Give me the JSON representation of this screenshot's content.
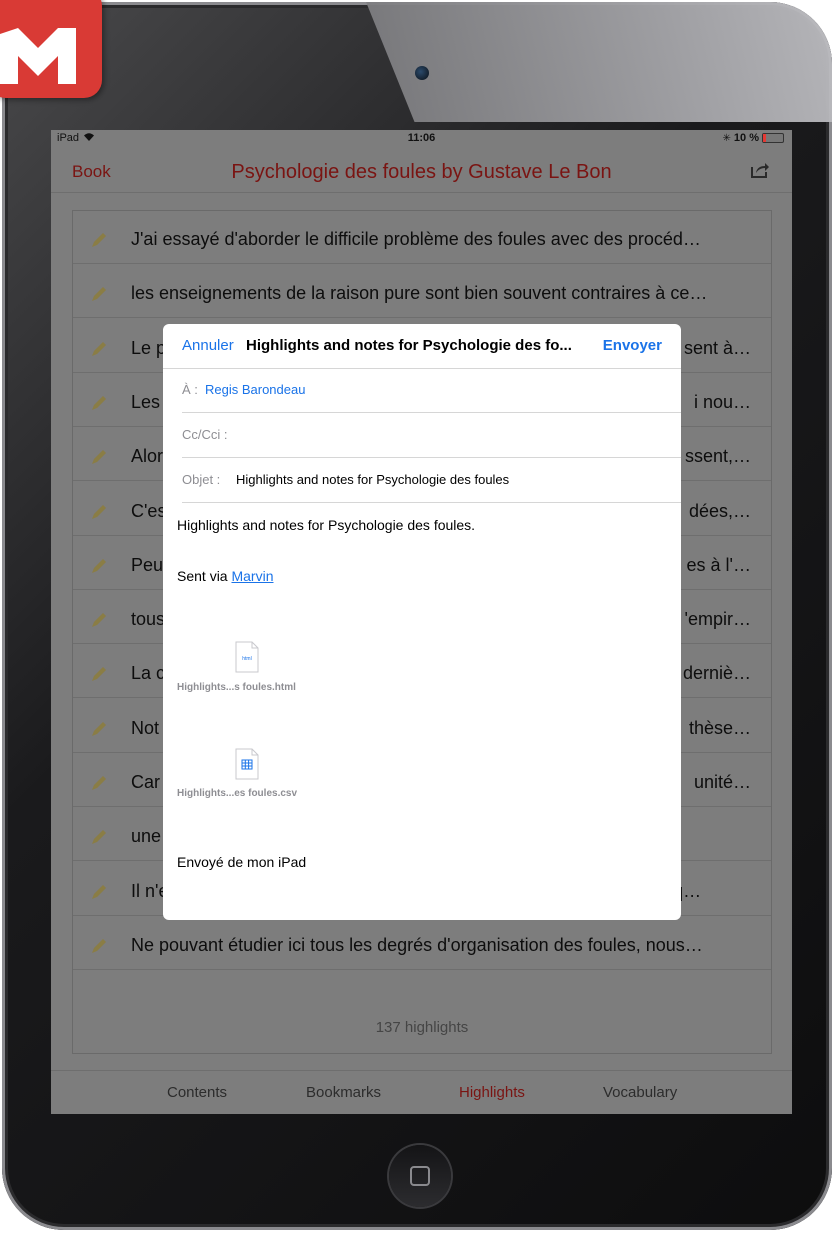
{
  "status": {
    "device": "iPad",
    "time": "11:06",
    "battery": "10 %"
  },
  "nav": {
    "back": "Book",
    "title": "Psychologie des foules by Gustave Le Bon",
    "share_icon": "share-icon"
  },
  "highlights": [
    "J'ai essayé d'aborder le difficile problème des foules avec des procéd…",
    "les enseignements de la raison  pure sont bien souvent contraires à ce…",
    "Le p",
    "Les",
    "Alor",
    "C'es",
    "Peu",
    "tous",
    "La c",
    "Not",
    "Car",
    "une",
    "Il n'est pas facile de décrire avec exactitude l'âme  des foules, parce q…",
    "Ne pouvant étudier ici tous les degrés d'organisation des foules, nous…"
  ],
  "highlights_right": [
    "",
    "",
    "sent à…",
    "i nou…",
    "ssent,…",
    "dées,…",
    "es à l'…",
    "'empir…",
    "derniè…",
    "thèse…",
    "unité…",
    "",
    "",
    ""
  ],
  "count": "137 highlights",
  "tabs": [
    "Contents",
    "Bookmarks",
    "Highlights",
    "Vocabulary"
  ],
  "compose": {
    "cancel": "Annuler",
    "title": "Highlights and notes for Psychologie des fo...",
    "send": "Envoyer",
    "to_label": "À :",
    "to_value": "Regis Barondeau",
    "cc_label": "Cc/Cci :",
    "subject_label": "Objet :",
    "subject_value": "Highlights and notes for Psychologie des foules",
    "body": "Highlights and notes for Psychologie des foules.",
    "sent_via": "Sent via",
    "sent_link": "Marvin",
    "attachments": [
      {
        "name": "Highlights...s foules.html",
        "icon": "html-file-icon",
        "icon_text": "html"
      },
      {
        "name": "Highlights...es foules.csv",
        "icon": "csv-file-icon"
      }
    ],
    "signature": "Envoyé de mon iPad"
  },
  "colors": {
    "accent_red": "#c0302b",
    "link_blue": "#1a73e8"
  }
}
